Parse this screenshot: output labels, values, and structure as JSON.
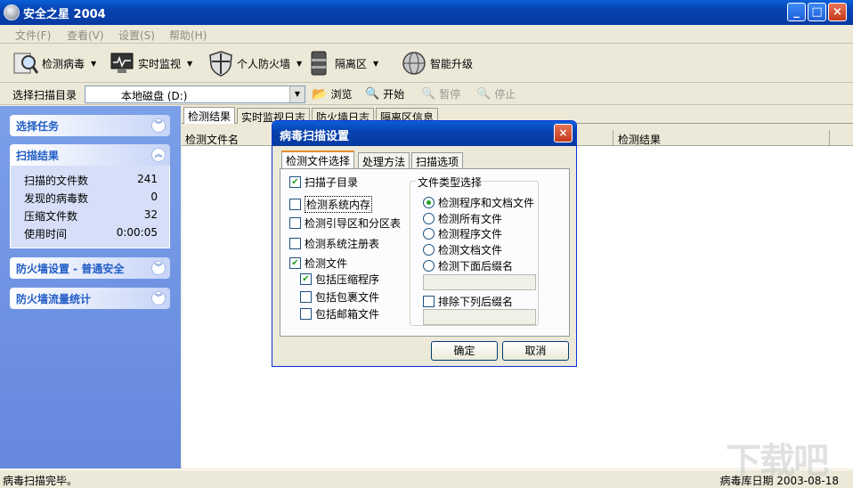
{
  "window": {
    "title": "安全之星  2004"
  },
  "menu": [
    {
      "label": "文件(F)"
    },
    {
      "label": "查看(V)"
    },
    {
      "label": "设置(S)"
    },
    {
      "label": "帮助(H)"
    }
  ],
  "toolbar": {
    "scan": "检测病毒",
    "monitor": "实时监视",
    "firewall": "个人防火墙",
    "quarantine": "隔离区",
    "upgrade": "智能升级"
  },
  "scanbar": {
    "label": "选择扫描目录",
    "drive": "本地磁盘  (D:)",
    "browse": "浏览",
    "start": "开始",
    "pause": "暂停",
    "stop": "停止"
  },
  "left": {
    "task_title": "选择任务",
    "results_title": "扫描结果",
    "stats": [
      {
        "label": "扫描的文件数",
        "value": "241"
      },
      {
        "label": "发现的病毒数",
        "value": "0"
      },
      {
        "label": "压缩文件数",
        "value": "32"
      },
      {
        "label": "使用时间",
        "value": "0:00:05"
      }
    ],
    "firewall_title": "防火墙设置 - 普通安全",
    "traffic_title": "防火墙流量统计"
  },
  "main": {
    "tabs": [
      "检测结果",
      "实时监视日志",
      "防火墙日志",
      "隔离区信息"
    ],
    "col_file": "检测文件名",
    "col_result": "检测结果"
  },
  "status": {
    "message": "病毒扫描完毕。",
    "db_date": "病毒库日期   2003-08-18"
  },
  "watermark": "下载吧",
  "dialog": {
    "title": "病毒扫描设置",
    "tabs": [
      "检测文件选择",
      "处理方法",
      "扫描选项"
    ],
    "options": {
      "subdir": "扫描子目录",
      "memory": "检测系统内存",
      "boot": "检测引导区和分区表",
      "registry": "检测系统注册表",
      "files": "检测文件",
      "zip": "包括压缩程序",
      "package": "包括包裹文件",
      "mail": "包括邮箱文件"
    },
    "group": {
      "title": "文件类型选择",
      "radios": [
        "检测程序和文档文件",
        "检测所有文件",
        "检测程序文件",
        "检测文档文件",
        "检测下面后缀名"
      ],
      "exclude": "排除下列后缀名"
    },
    "ok": "确定",
    "cancel": "取消"
  }
}
